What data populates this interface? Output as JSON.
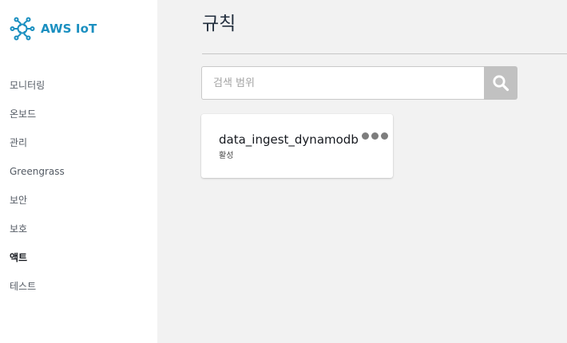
{
  "brand": {
    "name": "AWS IoT",
    "accent_color": "#1a8fc0",
    "icon": "iot-chip-icon"
  },
  "sidebar": {
    "items": [
      {
        "label": "모니터링",
        "active": false
      },
      {
        "label": "온보드",
        "active": false
      },
      {
        "label": "관리",
        "active": false
      },
      {
        "label": "Greengrass",
        "active": false
      },
      {
        "label": "보안",
        "active": false
      },
      {
        "label": "보호",
        "active": false
      },
      {
        "label": "액트",
        "active": true
      },
      {
        "label": "테스트",
        "active": false
      }
    ]
  },
  "main": {
    "title": "규칙",
    "search": {
      "placeholder": "검색 범위",
      "value": "",
      "button_icon": "search-icon"
    },
    "rules": [
      {
        "name": "data_ingest_dynamodb",
        "status": "활성",
        "menu_icon": "more-options-icon"
      }
    ]
  }
}
